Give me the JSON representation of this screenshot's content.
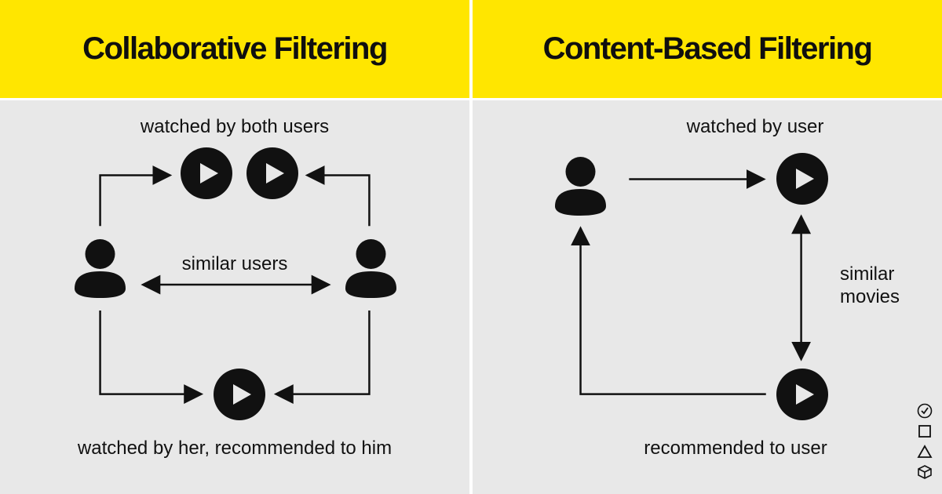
{
  "left": {
    "title": "Collaborative Filtering",
    "top_label": "watched by both users",
    "middle_label": "similar users",
    "bottom_label": "watched by her, recommended to him"
  },
  "right": {
    "title": "Content-Based Filtering",
    "top_label": "watched by user",
    "middle_label": "similar movies",
    "bottom_label": "recommended to user"
  },
  "icons": {
    "user": "user-icon",
    "play": "play-icon",
    "check": "check-icon",
    "square": "square-icon",
    "triangle": "triangle-icon",
    "cube": "cube-icon"
  },
  "colors": {
    "header_bg": "#ffe600",
    "panel_bg": "#e8e8e8",
    "ink": "#111111"
  }
}
